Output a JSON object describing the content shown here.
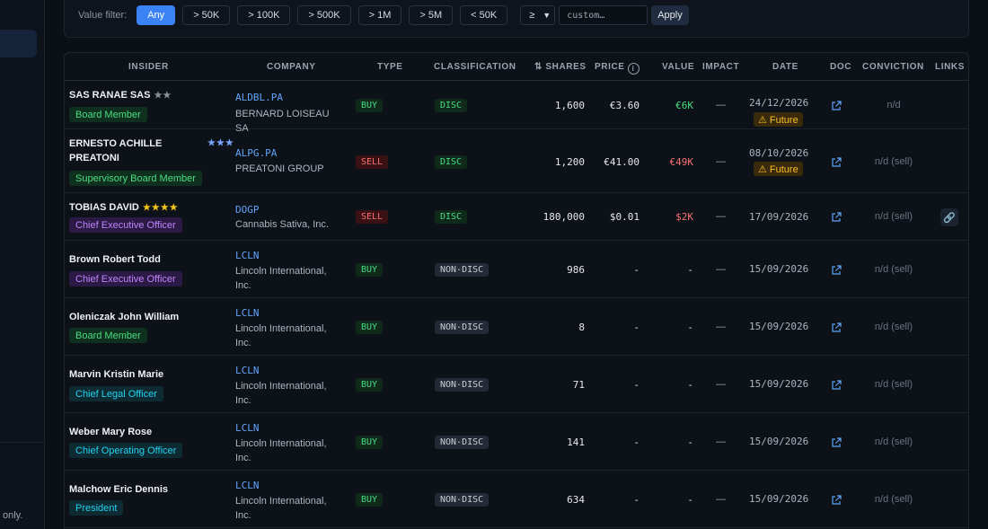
{
  "sidebar": {
    "footer_note": "only."
  },
  "filter": {
    "label": "Value filter:",
    "chips": [
      "Any",
      "> 50K",
      "> 100K",
      "> 500K",
      "> 1M",
      "> 5M",
      "< 50K"
    ],
    "active_chip": "Any",
    "operator": "≥",
    "custom_placeholder": "custom…",
    "apply_label": "Apply"
  },
  "table": {
    "headers": {
      "insider": "INSIDER",
      "company": "COMPANY",
      "type": "TYPE",
      "classification": "CLASSIFICATION",
      "shares": "⇅ SHARES",
      "price": "PRICE",
      "value": "VALUE",
      "impact": "IMPACT",
      "date": "DATE",
      "doc": "DOC",
      "conviction": "CONVICTION",
      "links": "LINKS"
    },
    "rows": [
      {
        "insider": "SAS RANAE SAS",
        "stars": "★★",
        "star_color": "gray",
        "role": "Board Member",
        "role_color": "green",
        "ticker": "ALDBL.PA",
        "company": "BERNARD LOISEAU SA",
        "type": "BUY",
        "classification": "DISC",
        "shares": "1,600",
        "price": "€3.60",
        "value": "€6K",
        "value_color": "green",
        "impact": "—",
        "date": "24/12/2026",
        "future": "⚠ Future",
        "conviction": "n/d",
        "link": ""
      },
      {
        "insider": "ERNESTO ACHILLE PREATONI",
        "stars": "★★★",
        "star_color": "blue",
        "role": "Supervisory Board Member",
        "role_color": "green",
        "ticker": "ALPG.PA",
        "company": "PREATONI GROUP",
        "type": "SELL",
        "classification": "DISC",
        "shares": "1,200",
        "price": "€41.00",
        "value": "€49K",
        "value_color": "red",
        "impact": "—",
        "date": "08/10/2026",
        "future": "⚠ Future",
        "conviction": "n/d (sell)",
        "link": ""
      },
      {
        "insider": "TOBIAS DAVID",
        "stars": "★★★★",
        "star_color": "gold",
        "role": "Chief Executive Officer",
        "role_color": "purple",
        "ticker": "DOGP",
        "company": "Cannabis Sativa, Inc.",
        "type": "SELL",
        "classification": "DISC",
        "shares": "180,000",
        "price": "$0.01",
        "value": "$2K",
        "value_color": "red",
        "impact": "—",
        "date": "17/09/2026",
        "future": "",
        "conviction": "n/d (sell)",
        "link": "🔗"
      },
      {
        "insider": "Brown Robert Todd",
        "stars": "",
        "star_color": "gray",
        "role": "Chief Executive Officer",
        "role_color": "purple",
        "ticker": "LCLN",
        "company": "Lincoln International, Inc.",
        "type": "BUY",
        "classification": "NON-DISC",
        "shares": "986",
        "price": "-",
        "value": "-",
        "value_color": "",
        "impact": "—",
        "date": "15/09/2026",
        "future": "",
        "conviction": "n/d (sell)",
        "link": ""
      },
      {
        "insider": "Oleniczak John William",
        "stars": "",
        "star_color": "gray",
        "role": "Board Member",
        "role_color": "green",
        "ticker": "LCLN",
        "company": "Lincoln International, Inc.",
        "type": "BUY",
        "classification": "NON-DISC",
        "shares": "8",
        "price": "-",
        "value": "-",
        "value_color": "",
        "impact": "—",
        "date": "15/09/2026",
        "future": "",
        "conviction": "n/d (sell)",
        "link": ""
      },
      {
        "insider": "Marvin Kristin Marie",
        "stars": "",
        "star_color": "gray",
        "role": "Chief Legal Officer",
        "role_color": "teal",
        "ticker": "LCLN",
        "company": "Lincoln International, Inc.",
        "type": "BUY",
        "classification": "NON-DISC",
        "shares": "71",
        "price": "-",
        "value": "-",
        "value_color": "",
        "impact": "—",
        "date": "15/09/2026",
        "future": "",
        "conviction": "n/d (sell)",
        "link": ""
      },
      {
        "insider": "Weber Mary Rose",
        "stars": "",
        "star_color": "gray",
        "role": "Chief Operating Officer",
        "role_color": "teal",
        "ticker": "LCLN",
        "company": "Lincoln International, Inc.",
        "type": "BUY",
        "classification": "NON-DISC",
        "shares": "141",
        "price": "-",
        "value": "-",
        "value_color": "",
        "impact": "—",
        "date": "15/09/2026",
        "future": "",
        "conviction": "n/d (sell)",
        "link": ""
      },
      {
        "insider": "Malchow Eric Dennis",
        "stars": "",
        "star_color": "gray",
        "role": "President",
        "role_color": "teal",
        "ticker": "LCLN",
        "company": "Lincoln International, Inc.",
        "type": "BUY",
        "classification": "NON-DISC",
        "shares": "634",
        "price": "-",
        "value": "-",
        "value_color": "",
        "impact": "—",
        "date": "15/09/2026",
        "future": "",
        "conviction": "n/d (sell)",
        "link": ""
      }
    ]
  },
  "icons": {
    "doc": "external-link-icon",
    "link": "link-icon",
    "info": "info-icon"
  }
}
